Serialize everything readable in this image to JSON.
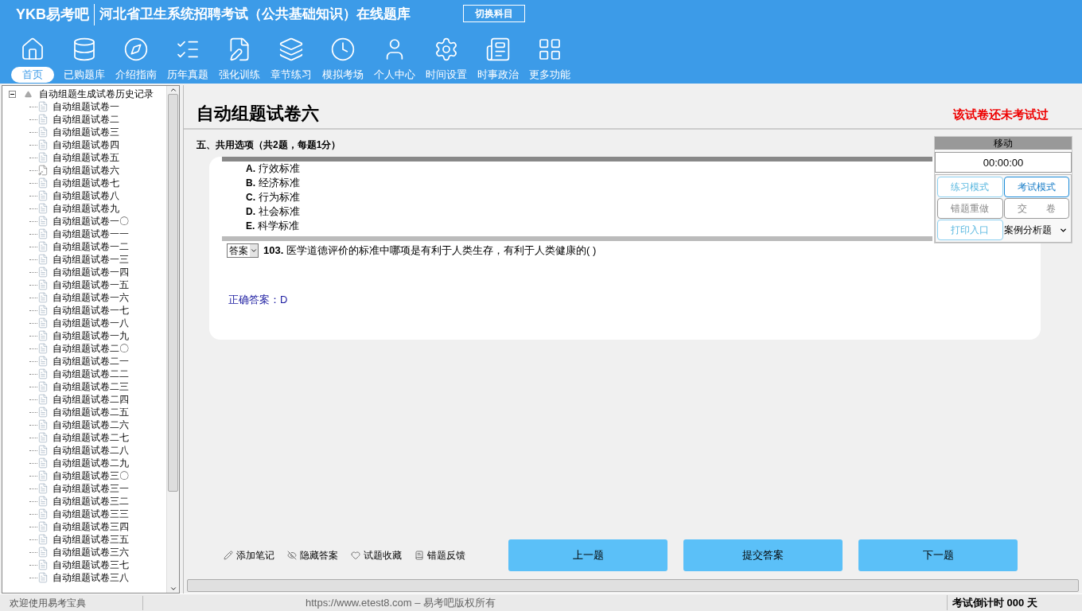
{
  "header": {
    "logo": "YKB易考吧",
    "title": "河北省卫生系统招聘考试（公共基础知识）在线题库",
    "switch_button": "切换科目"
  },
  "nav": [
    {
      "label": "首页",
      "selected": true
    },
    {
      "label": "已购题库",
      "selected": false
    },
    {
      "label": "介绍指南",
      "selected": false
    },
    {
      "label": "历年真题",
      "selected": false
    },
    {
      "label": "强化训练",
      "selected": false
    },
    {
      "label": "章节练习",
      "selected": false
    },
    {
      "label": "模拟考场",
      "selected": false
    },
    {
      "label": "个人中心",
      "selected": false
    },
    {
      "label": "时间设置",
      "selected": false
    },
    {
      "label": "时事政治",
      "selected": false
    },
    {
      "label": "更多功能",
      "selected": false
    }
  ],
  "tree": {
    "label": "自动组题生成试卷历史记录",
    "expanded": true,
    "children": [
      {
        "label": "自动组题试卷一",
        "active": false
      },
      {
        "label": "自动组题试卷二",
        "active": false
      },
      {
        "label": "自动组题试卷三",
        "active": false
      },
      {
        "label": "自动组题试卷四",
        "active": false
      },
      {
        "label": "自动组题试卷五",
        "active": false
      },
      {
        "label": "自动组题试卷六",
        "active": true
      },
      {
        "label": "自动组题试卷七",
        "active": false
      },
      {
        "label": "自动组题试卷八",
        "active": false
      },
      {
        "label": "自动组题试卷九",
        "active": false
      },
      {
        "label": "自动组题试卷一〇",
        "active": false
      },
      {
        "label": "自动组题试卷一一",
        "active": false
      },
      {
        "label": "自动组题试卷一二",
        "active": false
      },
      {
        "label": "自动组题试卷一三",
        "active": false
      },
      {
        "label": "自动组题试卷一四",
        "active": false
      },
      {
        "label": "自动组题试卷一五",
        "active": false
      },
      {
        "label": "自动组题试卷一六",
        "active": false
      },
      {
        "label": "自动组题试卷一七",
        "active": false
      },
      {
        "label": "自动组题试卷一八",
        "active": false
      },
      {
        "label": "自动组题试卷一九",
        "active": false
      },
      {
        "label": "自动组题试卷二〇",
        "active": false
      },
      {
        "label": "自动组题试卷二一",
        "active": false
      },
      {
        "label": "自动组题试卷二二",
        "active": false
      },
      {
        "label": "自动组题试卷二三",
        "active": false
      },
      {
        "label": "自动组题试卷二四",
        "active": false
      },
      {
        "label": "自动组题试卷二五",
        "active": false
      },
      {
        "label": "自动组题试卷二六",
        "active": false
      },
      {
        "label": "自动组题试卷二七",
        "active": false
      },
      {
        "label": "自动组题试卷二八",
        "active": false
      },
      {
        "label": "自动组题试卷二九",
        "active": false
      },
      {
        "label": "自动组题试卷三〇",
        "active": false
      },
      {
        "label": "自动组题试卷三一",
        "active": false
      },
      {
        "label": "自动组题试卷三二",
        "active": false
      },
      {
        "label": "自动组题试卷三三",
        "active": false
      },
      {
        "label": "自动组题试卷三四",
        "active": false
      },
      {
        "label": "自动组题试卷三五",
        "active": false
      },
      {
        "label": "自动组题试卷三六",
        "active": false
      },
      {
        "label": "自动组题试卷三七",
        "active": false
      },
      {
        "label": "自动组题试卷三八",
        "active": false
      }
    ]
  },
  "paper": {
    "title": "自动组题试卷六",
    "status": "该试卷还未考试过",
    "section": "五、共用选项（共2题，每题1分）",
    "options": [
      {
        "letter": "A.",
        "text": "疗效标准"
      },
      {
        "letter": "B.",
        "text": "经济标准"
      },
      {
        "letter": "C.",
        "text": "行为标准"
      },
      {
        "letter": "D.",
        "text": "社会标准"
      },
      {
        "letter": "E.",
        "text": "科学标准"
      }
    ],
    "answer_select": "答案",
    "question_number": "103.",
    "question": "医学道德评价的标准中哪项是有利于人类生存，有利于人类健康的( )",
    "correct_answer": "正确答案：D"
  },
  "panel": {
    "title": "移动",
    "timer": "00:00:00",
    "modes": [
      {
        "label": "练习模式",
        "selected": false
      },
      {
        "label": "考试模式",
        "selected": true
      }
    ],
    "actions": [
      {
        "label": "错题重做",
        "disabled": true
      },
      {
        "label": "交　　卷",
        "disabled": true
      },
      {
        "label": "打印入口",
        "disabled": false
      }
    ],
    "type_select": "案例分析题"
  },
  "tools": [
    "添加笔记",
    "隐藏答案",
    "试题收藏",
    "错题反馈"
  ],
  "buttons": [
    "上一题",
    "提交答案",
    "下一题"
  ],
  "status_bar": {
    "welcome": "欢迎使用易考宝典",
    "copyright": "https://www.etest8.com – 易考吧版权所有",
    "countdown": "考试倒计时 000 天"
  }
}
